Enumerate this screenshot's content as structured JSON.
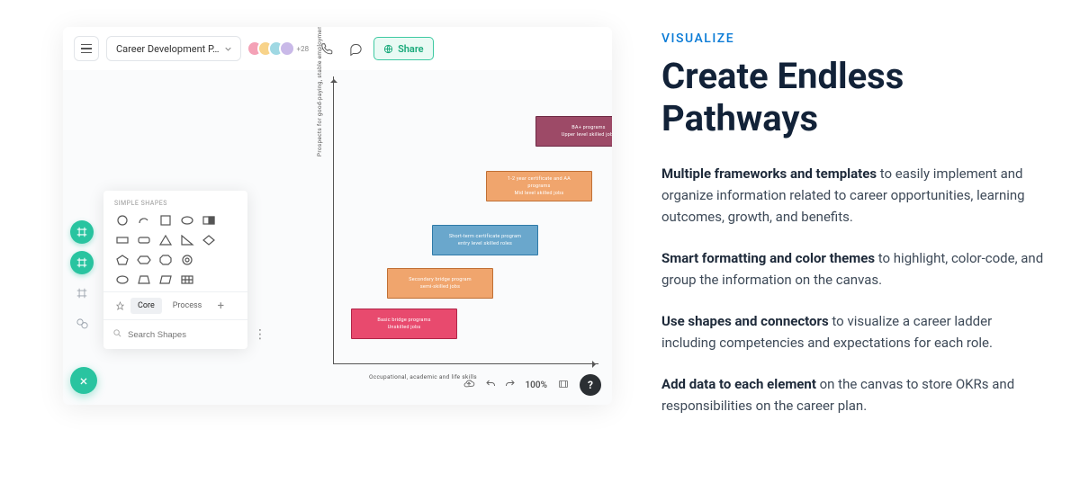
{
  "toolbar": {
    "doc_title": "Career Development P…",
    "share_label": "Share",
    "avatar_extra": "+28"
  },
  "panel": {
    "heading": "SIMPLE SHAPES",
    "tabs": {
      "core": "Core",
      "process": "Process"
    },
    "search_placeholder": "Search Shapes"
  },
  "axes": {
    "y": "Prospects   for  good-paying,    stable   employment",
    "x": "Occupational,    academic   and   life  skills"
  },
  "steps": [
    {
      "l1": "Basic  bridge  programs",
      "l2": "Unskilled  jobs",
      "bg": "#e84a6e",
      "bd": "#b02548"
    },
    {
      "l1": "Secondary  bridge  program",
      "l2": "semi-skilled   jobs",
      "bg": "#f0a56d",
      "bd": "#c07035"
    },
    {
      "l1": "Short-term   certificate   program",
      "l2": "entry   level  skilled  roles",
      "bg": "#6aa7cc",
      "bd": "#2f7aa8"
    },
    {
      "l1": "1-2  year  certificate   and  AA",
      "l2": "programs",
      "l3": "Mid  level  skilled  jobs",
      "bg": "#f0a56d",
      "bd": "#c07035"
    },
    {
      "l1": "BA+  programs",
      "l2": "Upper  level  skilled  jobs",
      "bg": "#9d4a67",
      "bd": "#6d2944"
    }
  ],
  "zoom": "100%",
  "marketing": {
    "category": "VISUALIZE",
    "title": "Create Endless Pathways",
    "p1_bold": "Multiple frameworks and templates",
    "p1_rest": " to easily implement and organize information related to career opportunities, learning outcomes, growth, and benefits.",
    "p2_bold": "Smart formatting and color themes",
    "p2_rest": " to highlight, color-code, and group the information on the canvas.",
    "p3_bold": "Use shapes and connectors",
    "p3_rest": " to visualize a career ladder including competencies and expectations for each role.",
    "p4_bold": "Add data to each element",
    "p4_rest": " on the canvas to store OKRs and responsibilities on the career plan."
  }
}
